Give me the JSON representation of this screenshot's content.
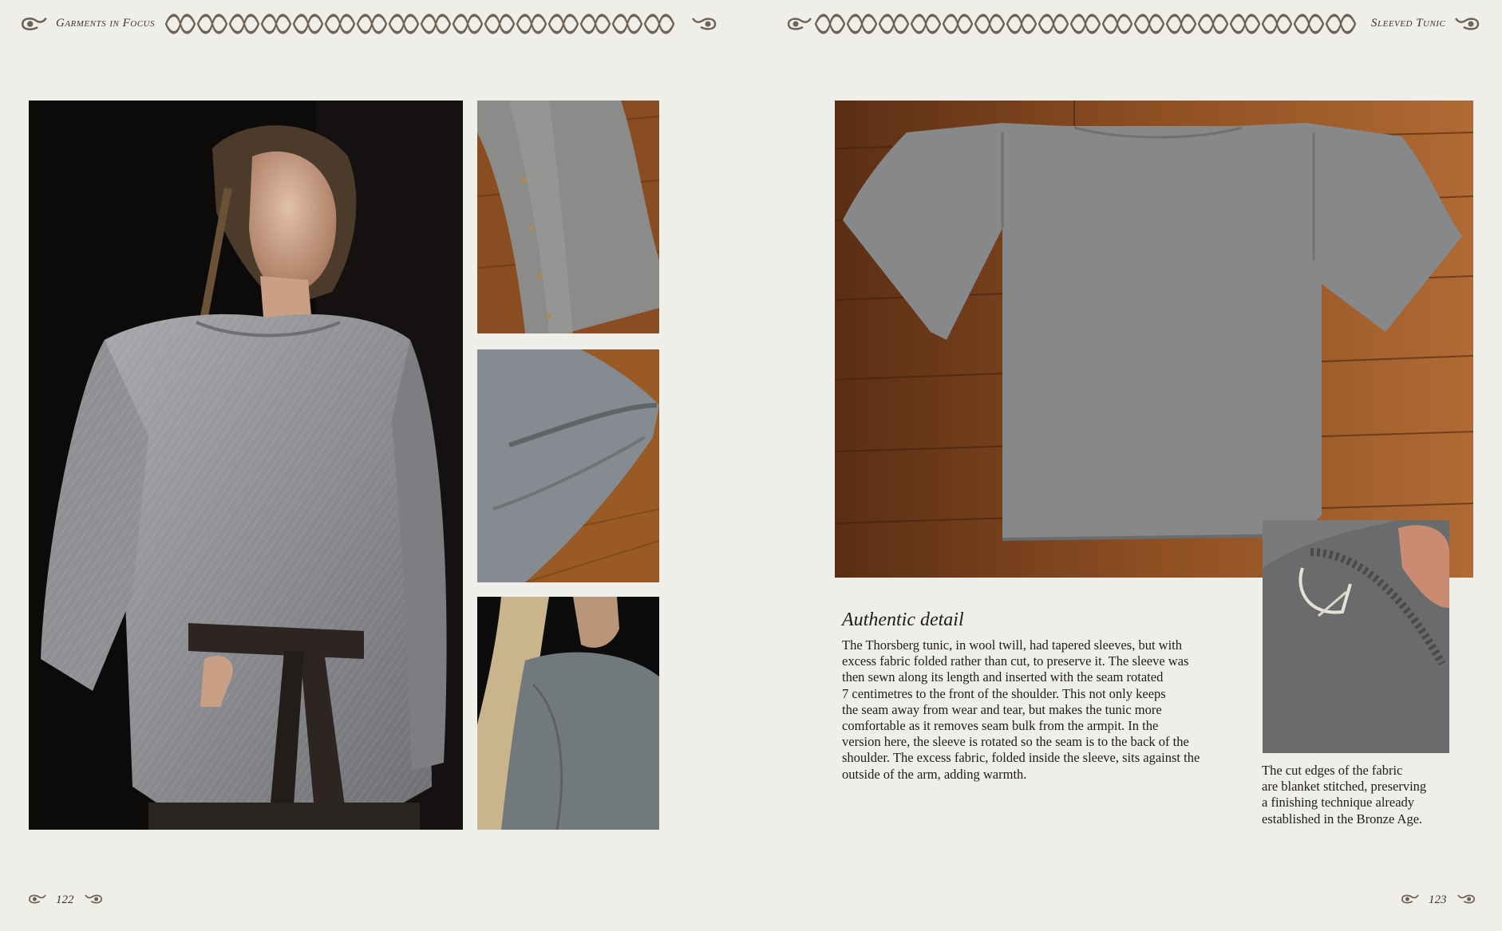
{
  "header": {
    "left_running_title": "Garments in Focus",
    "right_running_title": "Sleeved Tunic"
  },
  "left_page": {
    "page_number": "122",
    "images": [
      {
        "name": "woman-wearing-tunic-photo",
        "alt": "woman wearing grey tunic with belt"
      },
      {
        "name": "sleeve-pinned-photo",
        "alt": "sleeve pinned detail"
      },
      {
        "name": "sleeve-folded-photo",
        "alt": "sleeve fold detail"
      },
      {
        "name": "shoulder-seam-photo",
        "alt": "shoulder seam detail"
      }
    ]
  },
  "right_page": {
    "page_number": "123",
    "main_image": {
      "alt": "grey tunic laid flat on wooden floor"
    },
    "inset_image": {
      "alt": "blanket stitched edge close-up"
    },
    "section": {
      "heading": "Authentic detail",
      "lines": [
        "The Thorsberg tunic, in wool twill, had tapered sleeves, but with",
        "excess fabric folded rather than cut, to preserve it. The sleeve was",
        "then sewn along its length and inserted with the seam rotated",
        "7 centimetres to the front of the shoulder. This not only keeps",
        "the seam away from wear and tear, but makes the tunic more",
        "comfortable as it removes seam bulk from the armpit. In the",
        "version here, the sleeve is rotated so the seam is to the back of the",
        "shoulder. The excess fabric, folded inside the sleeve, sits against the",
        "outside of the arm, adding warmth."
      ]
    },
    "inset_caption_lines": [
      "The cut edges of the fabric",
      "are blanket stitched, preserving",
      "a finishing technique already",
      "established in the Bronze Age."
    ]
  },
  "colors": {
    "paper": "#efeee9",
    "ornament": "#6e6354",
    "wool_grey": "#8a8b8a",
    "wood": "#8a4d22"
  }
}
